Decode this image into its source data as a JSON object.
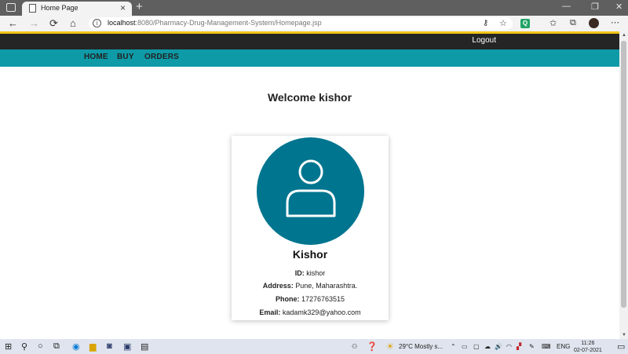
{
  "browser": {
    "tab_title": "Home Page",
    "tab_close": "×",
    "new_tab": "+",
    "url_host": "localhost",
    "url_path": ":8080/Pharmacy-Drug-Management-System/Homepage.jsp",
    "minimize": "—",
    "restore": "❐",
    "close": "✕",
    "back": "←",
    "forward": "→",
    "reload": "⟳",
    "home": "⌂",
    "ext_label": "Q"
  },
  "site": {
    "logout": "Logout",
    "nav": [
      "HOME",
      "BUY",
      "ORDERS"
    ],
    "welcome": "Welcome kishor",
    "accent_color": "#0e9aa7",
    "avatar_color": "#00758f"
  },
  "profile": {
    "name": "Kishor",
    "id_label": "ID:",
    "id_value": "kishor",
    "address_label": "Address:",
    "address_value": "Pune, Maharashtra.",
    "phone_label": "Phone:",
    "phone_value": "17276763515",
    "email_label": "Email:",
    "email_value": "kadamk329@yahoo.com"
  },
  "taskbar": {
    "weather": "29°C  Mostly s...",
    "language": "ENG",
    "time": "11:26",
    "date": "02-07-2021"
  }
}
